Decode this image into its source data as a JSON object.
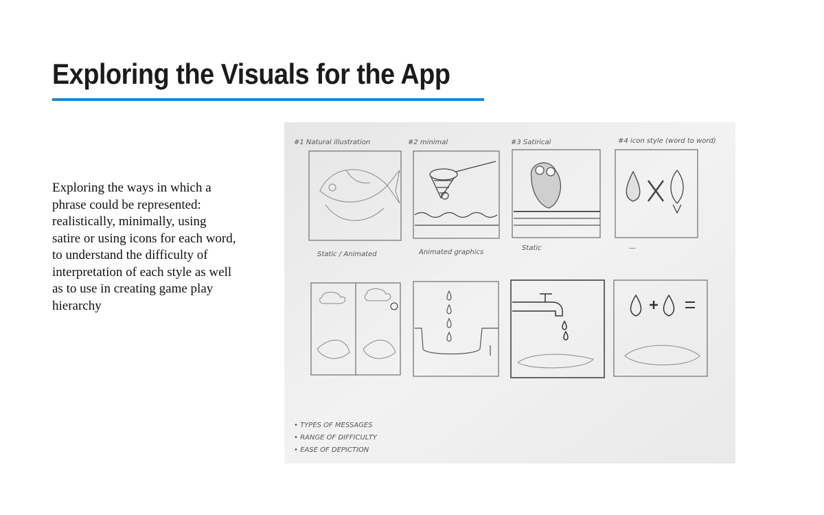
{
  "page": {
    "title": "Exploring the Visuals for the App",
    "body": "Exploring the ways in which a phrase could be represented: realistically, minimally, using satire or using icons for each word, to understand the difficulty of interpretation of each style as well as to use in creating game play hierarchy"
  },
  "sketch": {
    "labels": {
      "p1": "#1 Natural illustration",
      "p2": "#2 minimal",
      "p3": "#3 Satirical",
      "p4": "#4 icon style (word to word)"
    },
    "captions": {
      "c1": "Static / Animated",
      "c2": "Animated graphics",
      "c3": "Static",
      "c4": "—"
    },
    "notes": [
      "• TYPES OF MESSAGES",
      "• RANGE OF DIFFICULTY",
      "• EASE OF DEPICTION"
    ]
  },
  "colors": {
    "accent": "#1a87d1",
    "text": "#1b1b1b",
    "paper": "#efefef"
  }
}
